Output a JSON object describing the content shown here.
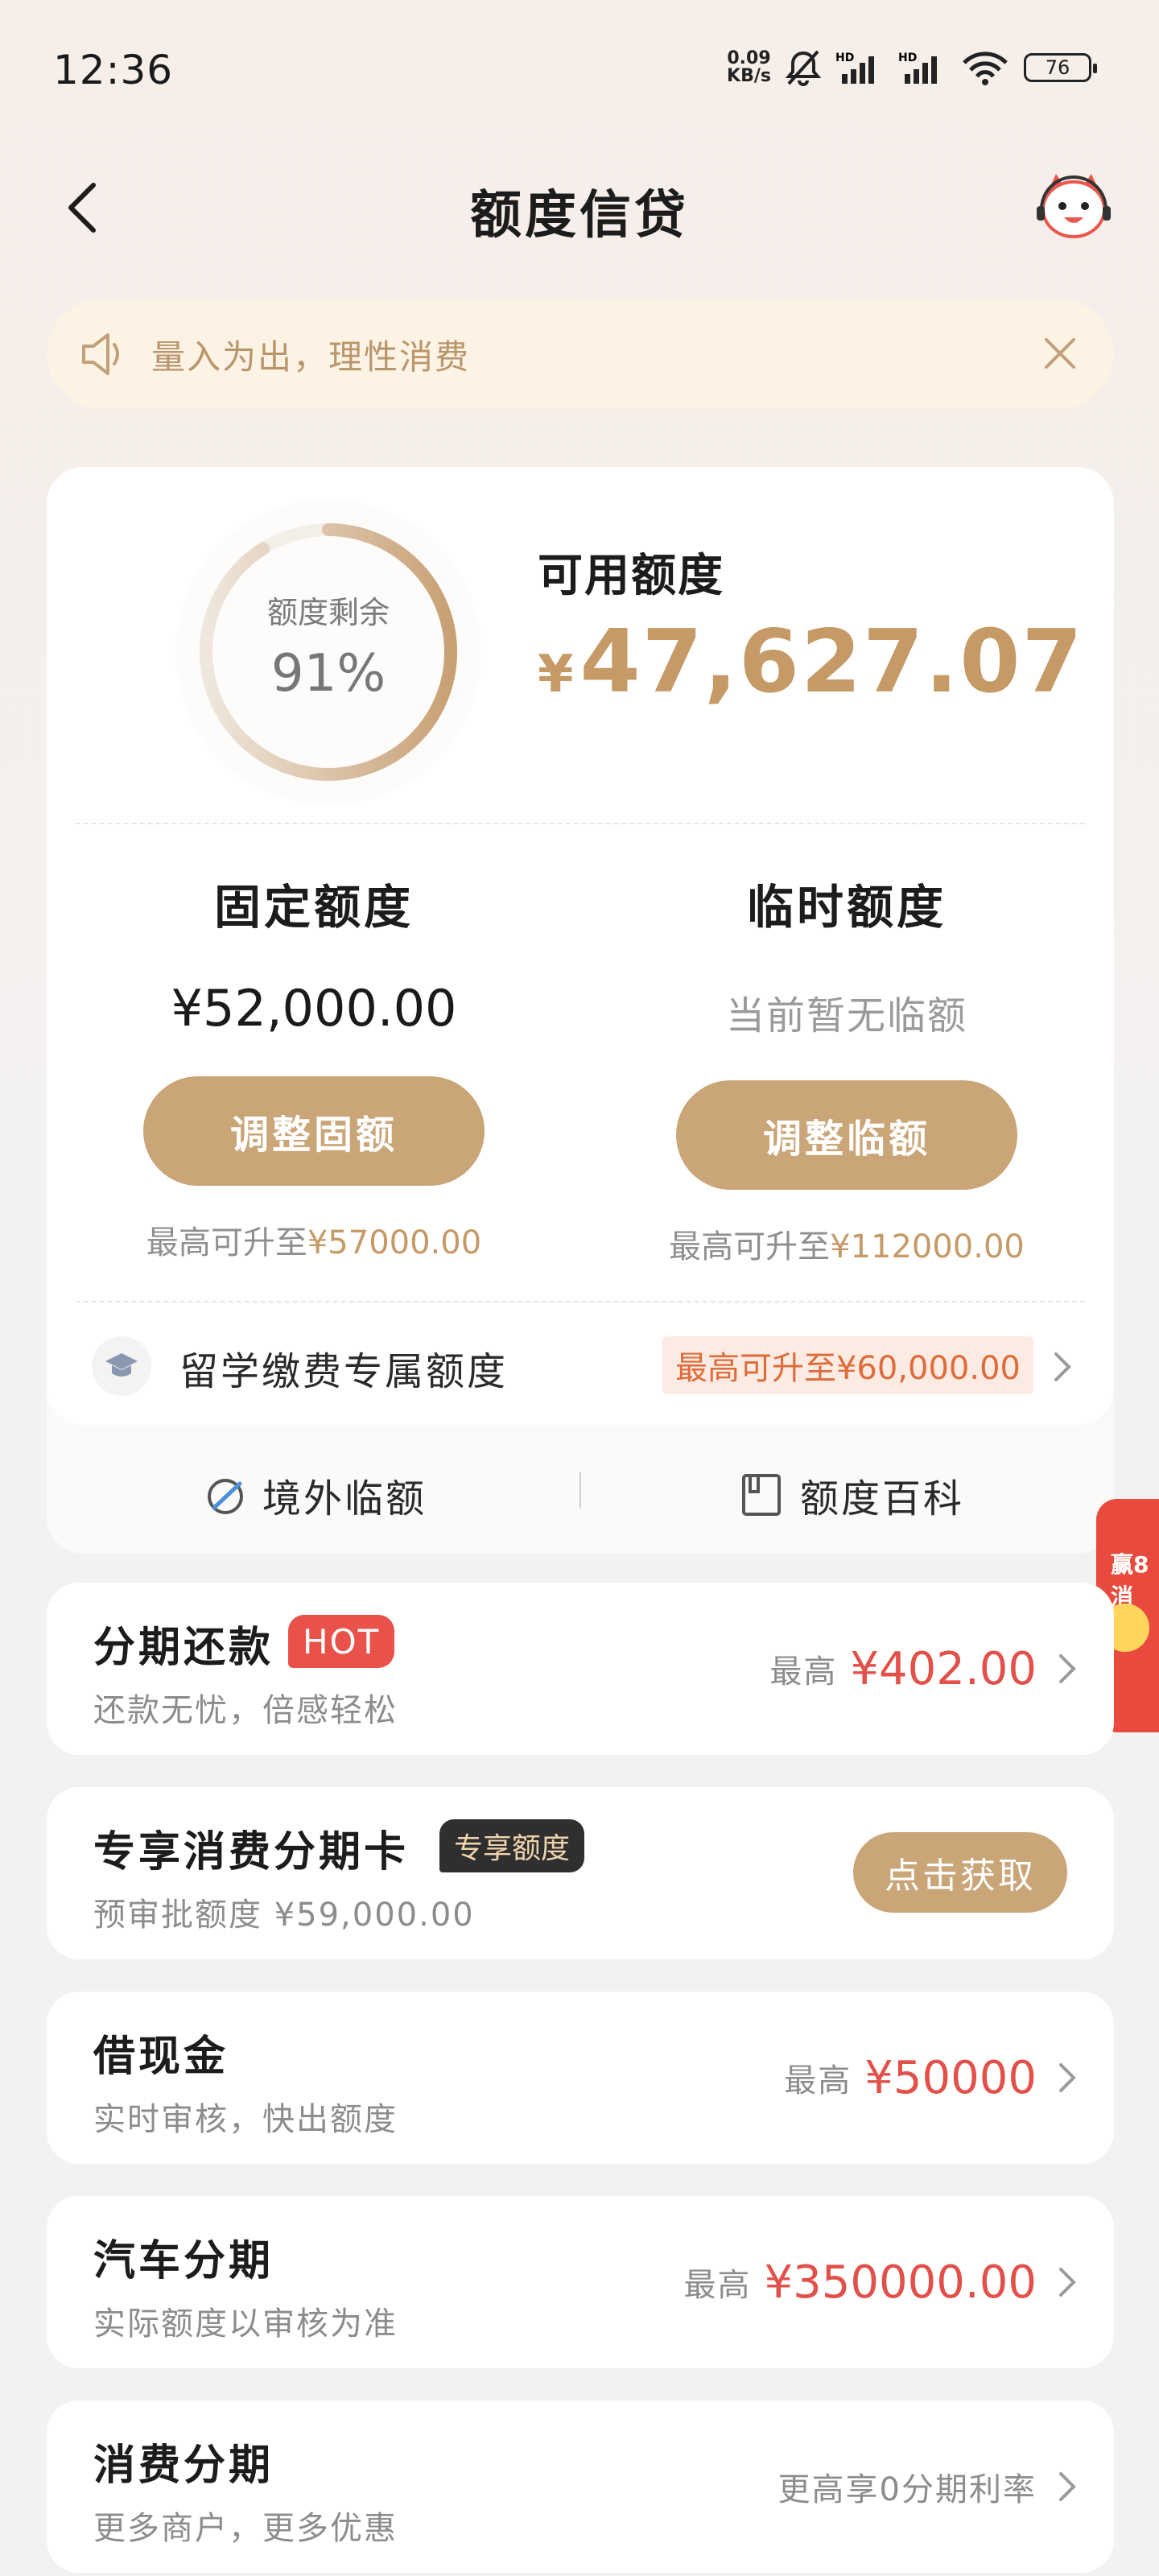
{
  "status_bar": {
    "time": "12:36",
    "net_speed_value": "0.09",
    "net_speed_unit": "KB/s",
    "battery": "76"
  },
  "header": {
    "title": "额度信贷"
  },
  "notice": {
    "text": "量入为出，理性消费"
  },
  "credit": {
    "ring_label": "额度剩余",
    "ring_percent": "91%",
    "ring_fraction": 0.91,
    "available_label": "可用额度",
    "available_currency": "¥",
    "available_amount": "47,627.07",
    "fixed": {
      "title": "固定额度",
      "amount": "¥52,000.00",
      "button": "调整固额",
      "limit_prefix": "最高可升至",
      "limit_value": "¥57000.00"
    },
    "temp": {
      "title": "临时额度",
      "amount": "当前暂无临额",
      "button": "调整临额",
      "limit_prefix": "最高可升至",
      "limit_value": "¥112000.00"
    },
    "study": {
      "label": "留学缴费专属额度",
      "tag": "最高可升至¥60,000.00"
    },
    "links": {
      "overseas": "境外临额",
      "wiki": "额度百科"
    }
  },
  "float_badge": {
    "text": "赢8 消"
  },
  "products": [
    {
      "title": "分期还款",
      "badge": "HOT",
      "subtitle": "还款无忧，倍感轻松",
      "prefix": "最高",
      "amount": "¥402.00"
    },
    {
      "title": "专享消费分期卡",
      "badge": "专享额度",
      "subtitle": "预审批额度 ¥59,000.00",
      "button": "点击获取"
    },
    {
      "title": "借现金",
      "subtitle": "实时审核，快出额度",
      "prefix": "最高",
      "amount": "¥50000"
    },
    {
      "title": "汽车分期",
      "subtitle": "实际额度以审核为准",
      "prefix": "最高",
      "amount": "¥350000.00"
    },
    {
      "title": "消费分期",
      "subtitle": "更多商户，更多优惠",
      "rate": "更高享0分期利率"
    }
  ],
  "colors": {
    "gold": "#c59a67",
    "button_gold": "#c9a577",
    "red": "#e2504a",
    "notice_bg": "#fcf3e4"
  }
}
